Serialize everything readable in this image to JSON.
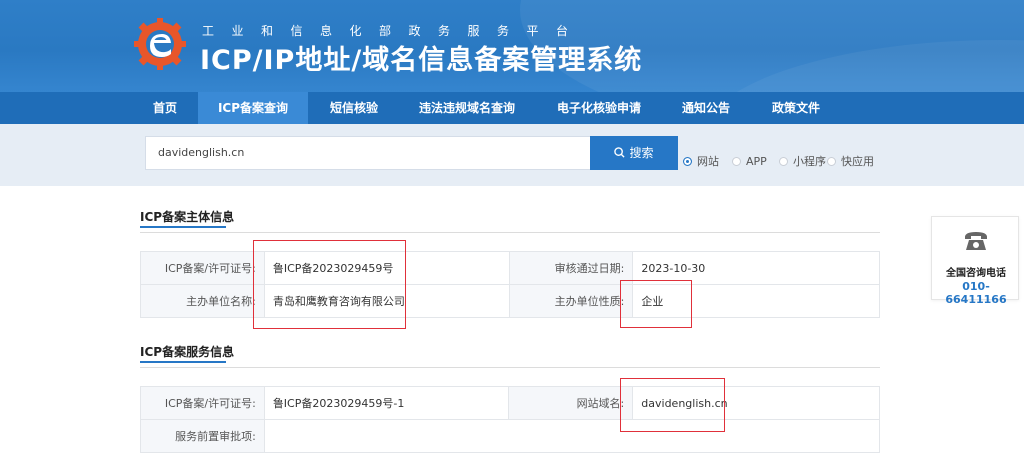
{
  "header": {
    "gov_line": "工业和信息化部政务服务平台",
    "title": "ICP/IP地址/域名信息备案管理系统"
  },
  "nav": {
    "items": [
      "首页",
      "ICP备案查询",
      "短信核验",
      "违法违规域名查询",
      "电子化核验申请",
      "通知公告",
      "政策文件"
    ],
    "active": "ICP备案查询"
  },
  "search": {
    "value": "davidenglish.cn",
    "button_label": "搜索",
    "options": [
      "网站",
      "APP",
      "小程序",
      "快应用"
    ],
    "selected": "网站"
  },
  "entity_section": {
    "title": "ICP备案主体信息",
    "rows": [
      {
        "k1": "ICP备案/许可证号:",
        "v1": "鲁ICP备2023029459号",
        "k2": "审核通过日期:",
        "v2": "2023-10-30"
      },
      {
        "k1": "主办单位名称:",
        "v1": "青岛和鹰教育咨询有限公司",
        "k2": "主办单位性质:",
        "v2": "企业"
      }
    ]
  },
  "service_section": {
    "title": "ICP备案服务信息",
    "rows": [
      {
        "k1": "ICP备案/许可证号:",
        "v1": "鲁ICP备2023029459号-1",
        "k2": "网站域名:",
        "v2": "davidenglish.cn"
      },
      {
        "k1": "服务前置审批项:",
        "v1": ""
      }
    ]
  },
  "contact": {
    "icon": "phone-icon",
    "label": "全国咨询电话",
    "phone": "010-66411166"
  },
  "colors": {
    "header_blue": "#2a79c2",
    "nav_blue": "#1f6db8",
    "accent": "#2677c6",
    "annotation_red": "#e0303a"
  }
}
